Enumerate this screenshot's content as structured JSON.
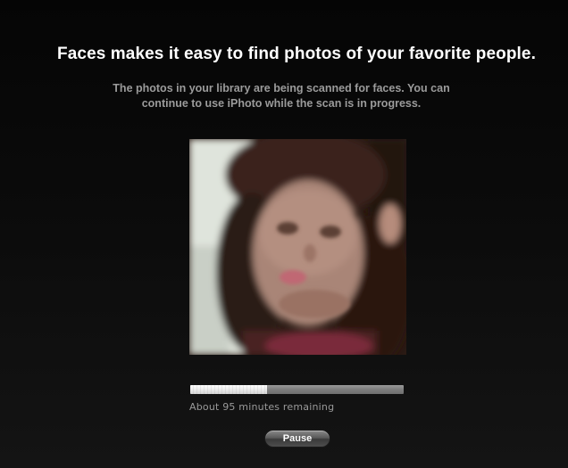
{
  "headline": "Faces makes it easy to find photos of your favorite people.",
  "description": {
    "line1": "The photos in your library are being scanned for faces. You can",
    "line2": "continue to use iPhoto while the scan is in progress."
  },
  "scan": {
    "progress_fraction": 0.36,
    "status_text": "About 95 minutes remaining"
  },
  "pause_button_label": "Pause",
  "colors": {
    "background": "#0b0b0b",
    "headline": "#ffffff",
    "subtext": "#9b9b9b",
    "progress_fill": "#eeeeee",
    "progress_track": "#7d7d7d"
  }
}
